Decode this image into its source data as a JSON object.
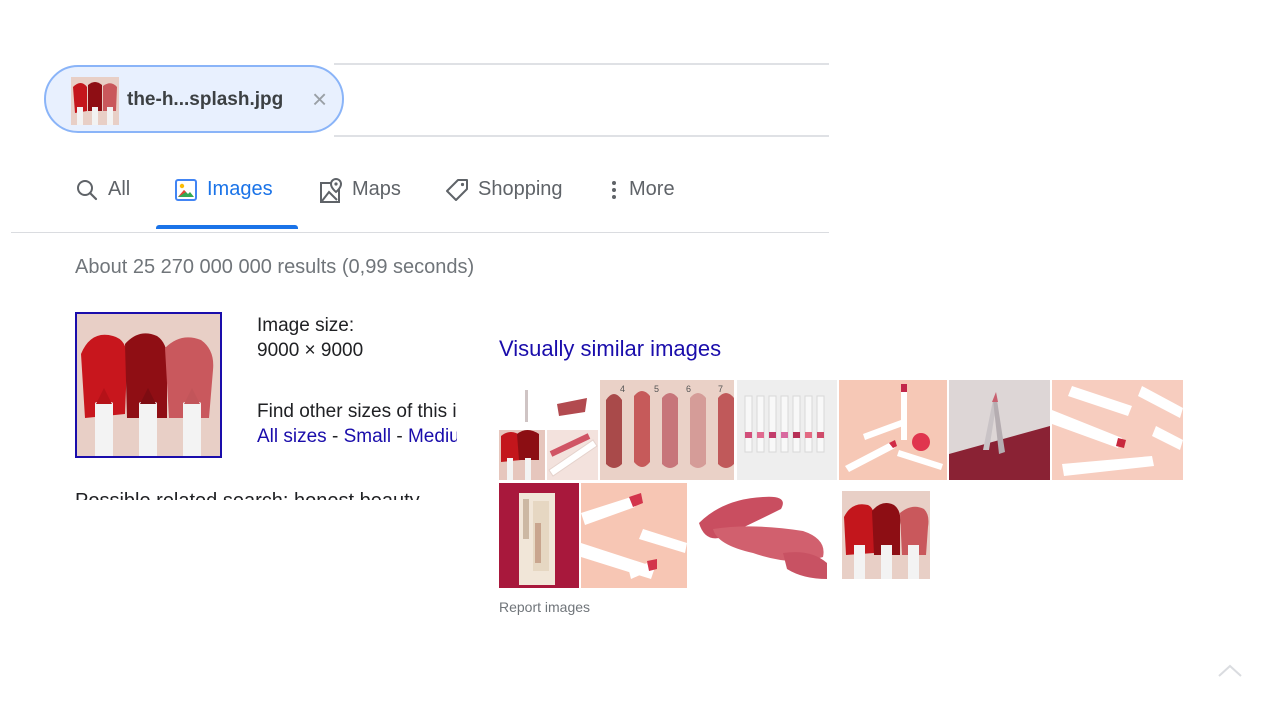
{
  "search": {
    "chip_label": "the-h...splash.jpg",
    "chip_close": "×"
  },
  "tabs": [
    {
      "label": "All",
      "icon": "search-icon"
    },
    {
      "label": "Images",
      "icon": "image-icon",
      "active": true
    },
    {
      "label": "Maps",
      "icon": "map-pin-icon"
    },
    {
      "label": "Shopping",
      "icon": "tag-icon"
    },
    {
      "label": "More",
      "icon": "more-vert-icon"
    }
  ],
  "results_stats": "About 25 270 000 000 results (0,99 seconds)",
  "query_image": {
    "size_label": "Image size:",
    "size_value": "9000 × 9000",
    "find_other": "Find other sizes of this image:",
    "links": [
      "All sizes",
      "Small",
      "Medium"
    ],
    "separator": " - ",
    "best_guess": "Possible related search: honest beauty"
  },
  "similar": {
    "title": "Visually similar images",
    "report": "Report images"
  },
  "colors": {
    "link": "#1a0dab",
    "accent": "#1a73e8",
    "chip_bg": "#e8f0fe"
  }
}
